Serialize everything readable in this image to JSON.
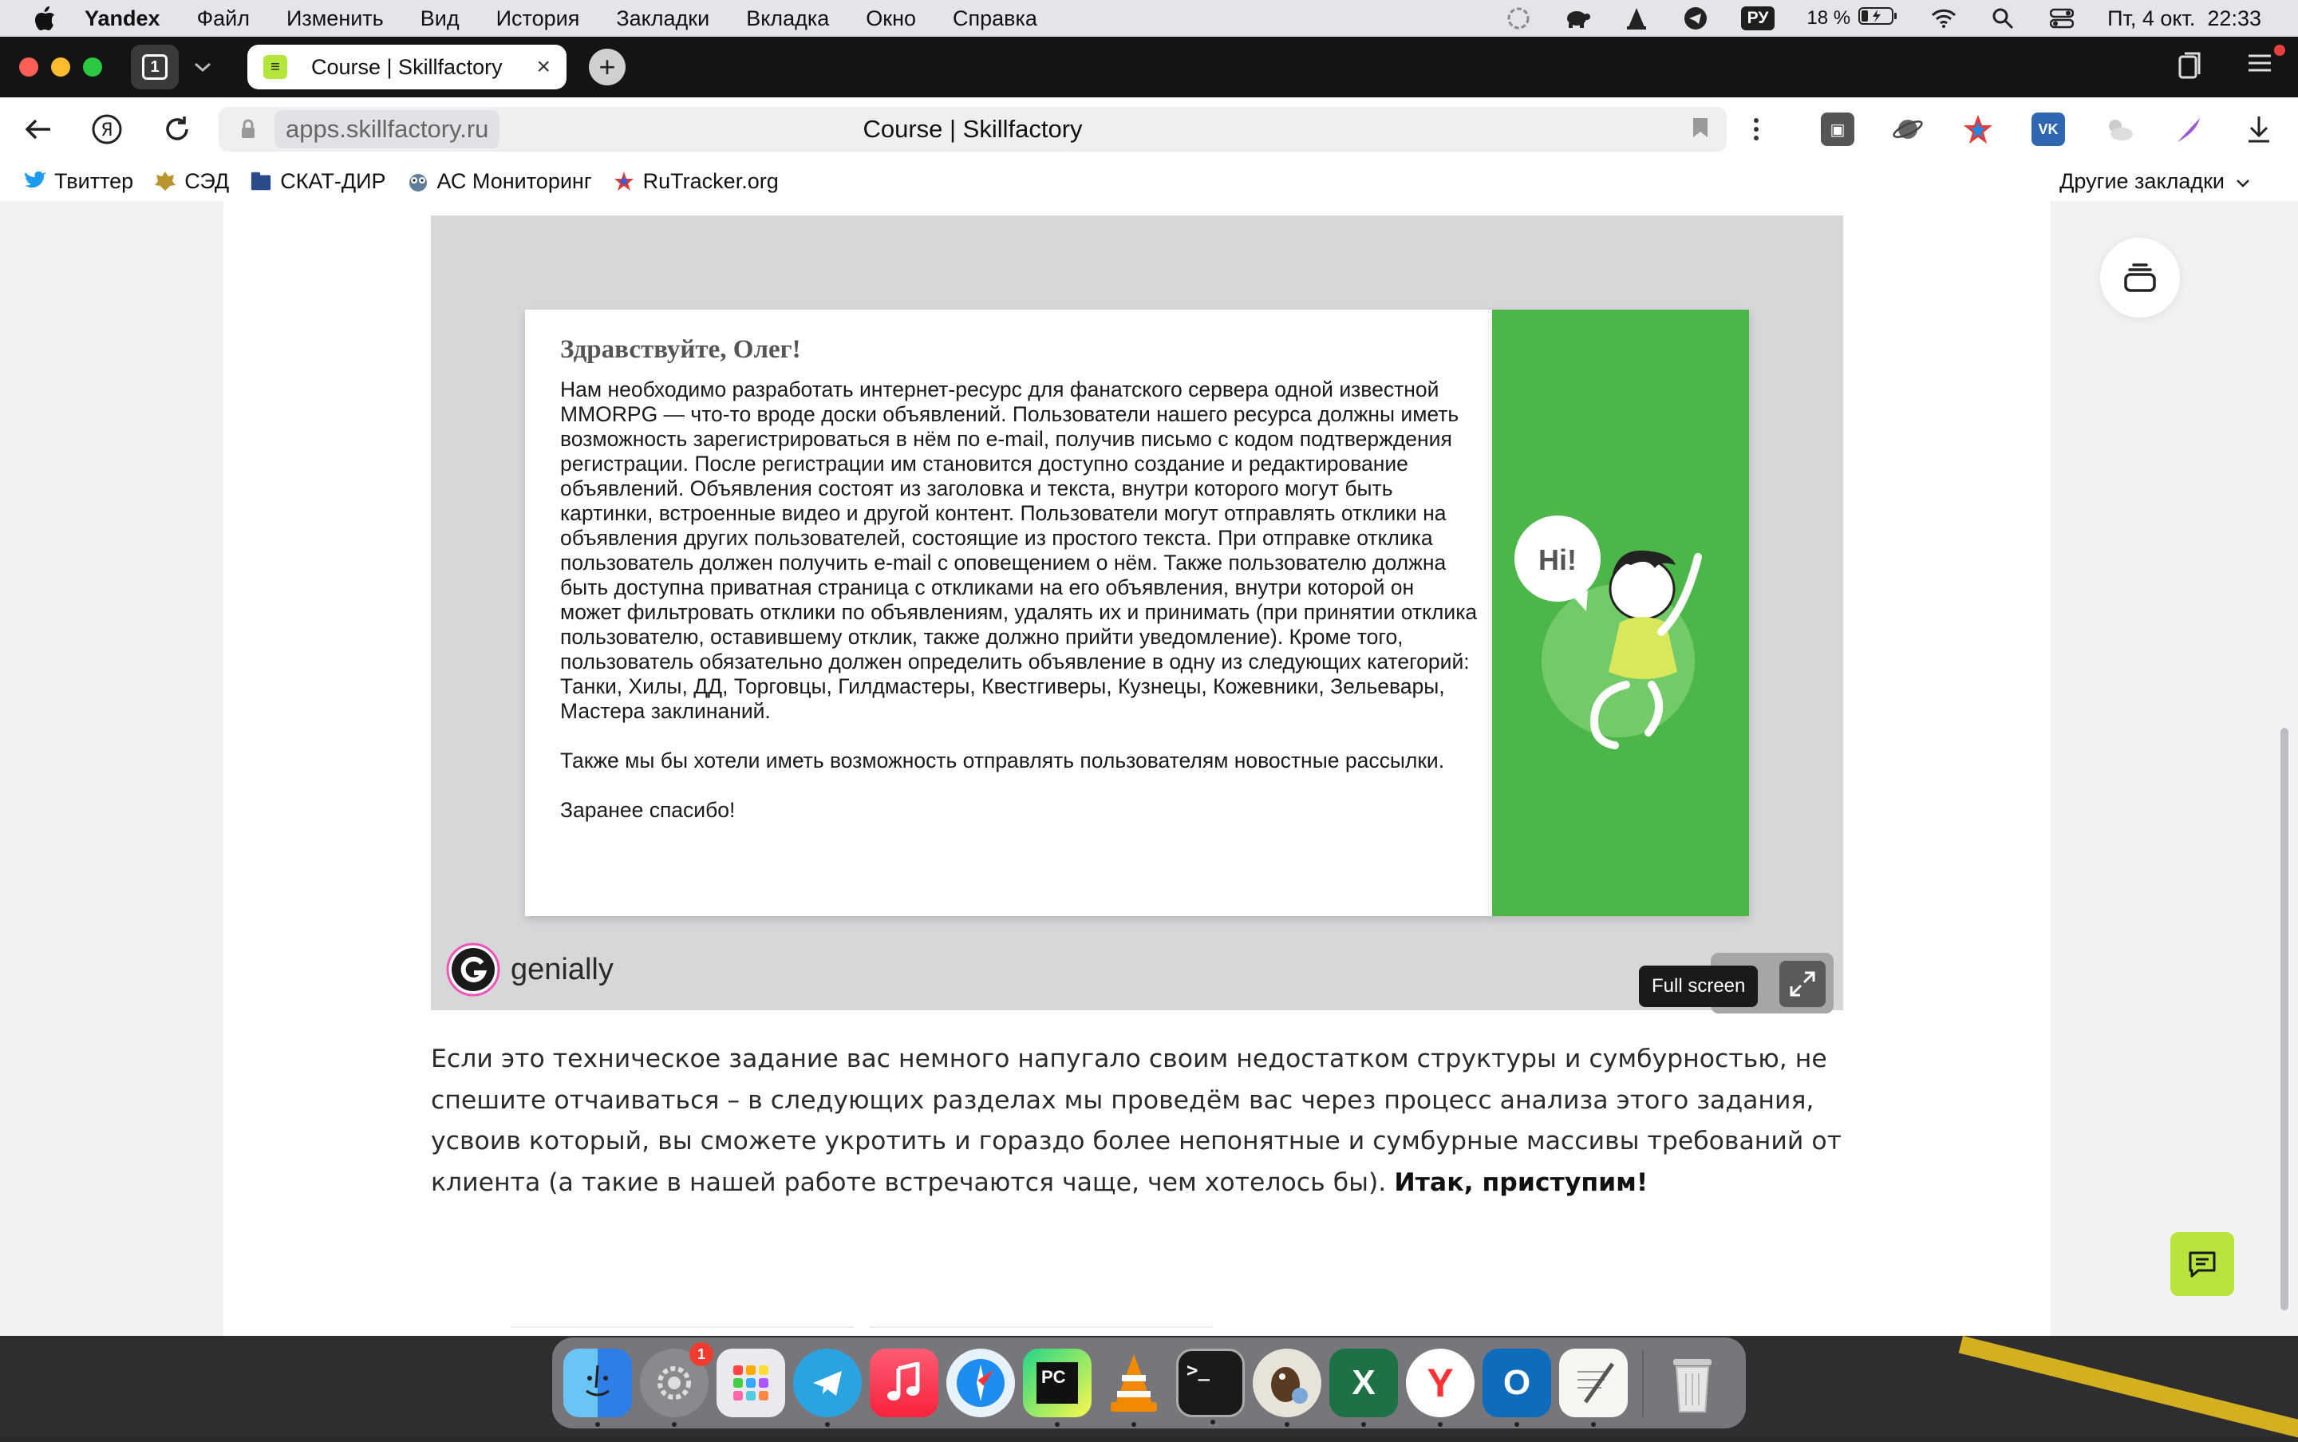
{
  "menubar": {
    "app_name": "Yandex",
    "items": [
      "Файл",
      "Изменить",
      "Вид",
      "История",
      "Закладки",
      "Вкладка",
      "Окно",
      "Справка"
    ],
    "input_source": "РУ",
    "battery": "18 %",
    "datetime": "Пт, 4 окт.  22:33"
  },
  "tabs": {
    "counter": "1",
    "active_title": "Course | Skillfactory",
    "close_glyph": "×",
    "new_tab_glyph": "+"
  },
  "address_bar": {
    "domain": "apps.skillfactory.ru",
    "page_title": "Course | Skillfactory"
  },
  "bookmarks": {
    "items": [
      {
        "label": "Твиттер",
        "icon": "twitter-icon"
      },
      {
        "label": "СЭД",
        "icon": "emblem-icon"
      },
      {
        "label": "СКАТ-ДИР",
        "icon": "folder-icon"
      },
      {
        "label": "АС Мониторинг",
        "icon": "owl-icon"
      },
      {
        "label": "RuTracker.org",
        "icon": "rutracker-icon"
      }
    ],
    "other_label": "Другие закладки"
  },
  "letter": {
    "title": "Здравствуйте, Олег!",
    "paragraphs": [
      "Нам необходимо разработать интернет-ресурс для фанатского сервера одной известной MMORPG — что-то вроде доски объявлений. Пользователи нашего ресурса должны иметь возможность зарегистрироваться в нём по e-mail, получив письмо с кодом подтверждения регистрации. После регистрации им становится доступно создание и редактирование объявлений. Объявления состоят из заголовка и текста, внутри которого могут быть картинки, встроенные видео и другой контент. Пользователи могут отправлять отклики на объявления других пользователей, состоящие из простого текста. При отправке отклика пользователь должен получить e-mail с оповещением о нём. Также пользователю должна быть доступна приватная страница с откликами на его объявления, внутри которой он может фильтровать отклики по объявлениям, удалять их и принимать (при принятии отклика пользователю, оставившему отклик, также должно прийти уведомление). Кроме того, пользователь обязательно должен определить объявление в одну из следующих категорий: Танки, Хилы, ДД, Торговцы, Гилдмастеры, Квестгиверы, Кузнецы, Кожевники, Зельевары, Мастера заклинаний.",
      "Также мы бы хотели иметь возможность отправлять пользователям новостные рассылки.",
      "Заранее спасибо!"
    ],
    "bubble": "Hi!"
  },
  "genially": {
    "brand": "genially",
    "fullscreen_tooltip": "Full screen"
  },
  "article": {
    "text": "Если это техническое задание вас немного напугало своим недостатком структуры и сумбурностью, не спешите отчаиваться – в следующих разделах мы проведём вас через процесс анализа этого задания, усвоив который, вы сможете укротить и гораздо более непонятные и сумбурные массивы требований от клиента (а такие в нашей работе встречаются чаще, чем хотелось бы). ",
    "bold_text": "Итак, приступим!"
  },
  "dock": {
    "settings_badge": "1",
    "pycharm_label": "PC",
    "excel_label": "X",
    "outlook_label": "O",
    "yandex_label": "Y",
    "terminal_label": ">_"
  },
  "colors": {
    "accent_green": "#4cb649",
    "skillfactory_lime": "#b7e53d"
  }
}
